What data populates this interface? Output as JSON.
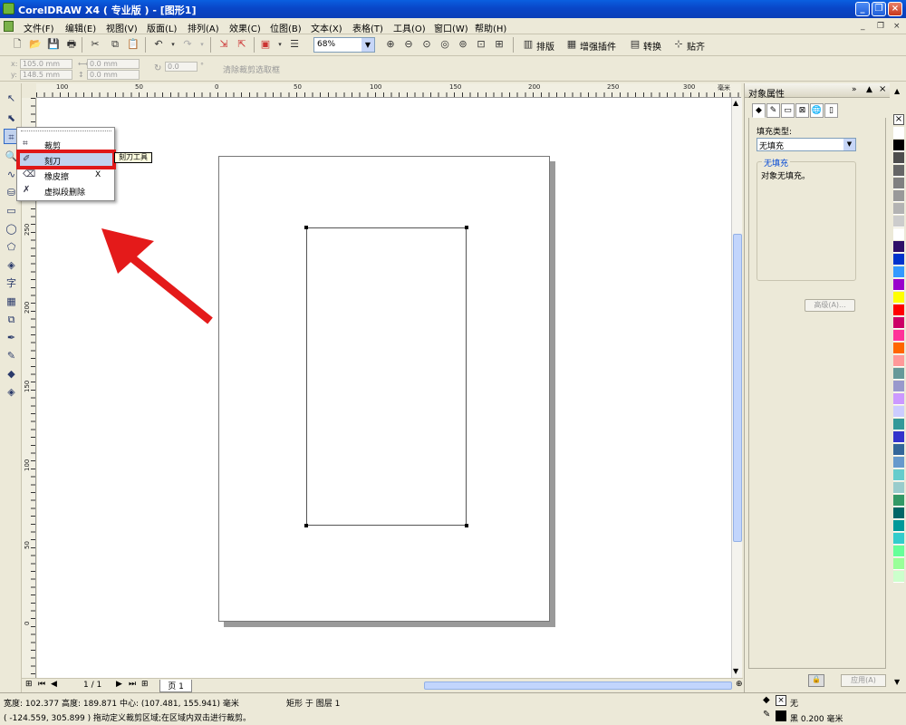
{
  "app": {
    "title": "CorelDRAW X4 ( 专业版 ) - [图形1]",
    "window_buttons": {
      "minimize": "_",
      "restore": "❐",
      "close": "×"
    },
    "mdi_buttons": {
      "minimize": "_",
      "restore": "❐",
      "close": "×"
    }
  },
  "menu": [
    "文件(F)",
    "编辑(E)",
    "视图(V)",
    "版面(L)",
    "排列(A)",
    "效果(C)",
    "位图(B)",
    "文本(X)",
    "表格(T)",
    "工具(O)",
    "窗口(W)",
    "帮助(H)"
  ],
  "toolbar": {
    "zoom": "68%",
    "layout_label": "排版",
    "plugins_label": "增强插件",
    "convert_label": "转换",
    "snap_label": "贴齐"
  },
  "propbar": {
    "x": "105.0 mm",
    "y": "148.5 mm",
    "w": "0.0 mm",
    "h": "0.0 mm",
    "angle": "0.0",
    "degree": "°",
    "clear_crop": "清除裁剪选取框"
  },
  "ruler": {
    "h_ticks": [
      "100",
      "50",
      "0",
      "50",
      "100",
      "150",
      "200",
      "250",
      "300"
    ],
    "h_unit": "毫米",
    "v_ticks": [
      "250",
      "200",
      "150",
      "100",
      "50",
      "0"
    ]
  },
  "flyout": {
    "items": [
      {
        "label": "裁剪",
        "shortcut": ""
      },
      {
        "label": "刻刀",
        "shortcut": ""
      },
      {
        "label": "橡皮擦",
        "shortcut": "X"
      },
      {
        "label": "虚拟段删除",
        "shortcut": ""
      }
    ],
    "tooltip": "刻刀工具"
  },
  "page_nav": {
    "page_count": "1 / 1",
    "page_tab": "页 1"
  },
  "docker": {
    "title": "对象属性",
    "fill_type_label": "填充类型:",
    "fill_type_value": "无填充",
    "group_title": "无填充",
    "group_desc": "对象无填充。",
    "advanced_button": "高级(A)...",
    "apply_button": "应用(A)"
  },
  "status": {
    "line1": "宽度: 102.377  高度: 189.871  中心: (107.481, 155.941)  毫米",
    "layer": "矩形 于 图层 1",
    "line2": "( -124.559, 305.899 )   拖动定义裁剪区域;在区域内双击进行裁剪。",
    "fill_none": "无",
    "outline": "黑  0.200 毫米"
  },
  "palette_colors": [
    "#ffffff",
    "#000000",
    "#4d4d4d",
    "#666666",
    "#808080",
    "#999999",
    "#b3b3b3",
    "#cccccc",
    "#ffffff",
    "#2e0f68",
    "#0033cc",
    "#3399ff",
    "#9900cc",
    "#ffff00",
    "#ff0000",
    "#cc0066",
    "#ff3399",
    "#ff6600",
    "#ff9999",
    "#669999",
    "#9999cc",
    "#cc99ff",
    "#ccccff",
    "#339999",
    "#3333cc",
    "#336699",
    "#6699cc",
    "#66cccc",
    "#99cccc",
    "#339966",
    "#006666",
    "#009999",
    "#33cccc",
    "#66ff99",
    "#99ff99",
    "#ccffcc"
  ],
  "accent": {
    "highlight": "#e01818",
    "arrow": "#e41a1a"
  }
}
